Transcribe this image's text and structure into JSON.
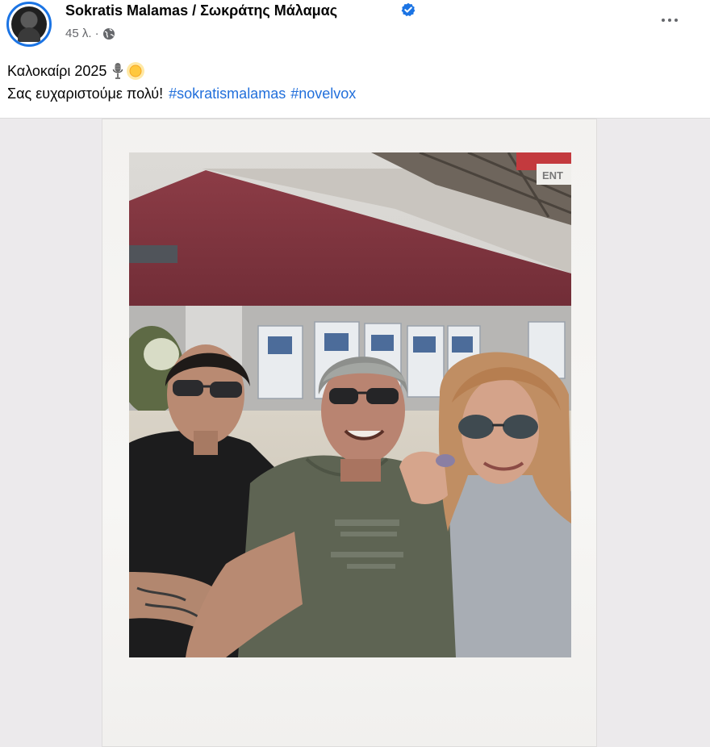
{
  "post": {
    "author": "Sokratis Malamas / Σωκράτης Μάλαμας",
    "verified": true,
    "time": "45 λ. ·",
    "audience_icon": "globe-icon",
    "more_icon": "more-options-icon",
    "text_line1": "Καλοκαίρι 2025",
    "text_line1_emojis": [
      "microphone-emoji",
      "sun-emoji"
    ],
    "text_line2": "Σας ευχαριστούμε πολύ!",
    "hashtags": [
      "#sokratismalamas",
      "#novelvox"
    ]
  },
  "media": {
    "type": "polaroid-photo",
    "sign_text": "ENT"
  },
  "colors": {
    "link": "#216fdb",
    "verified": "#1b74e4",
    "secondary_text": "#65676b",
    "media_bg": "#eceaec"
  }
}
